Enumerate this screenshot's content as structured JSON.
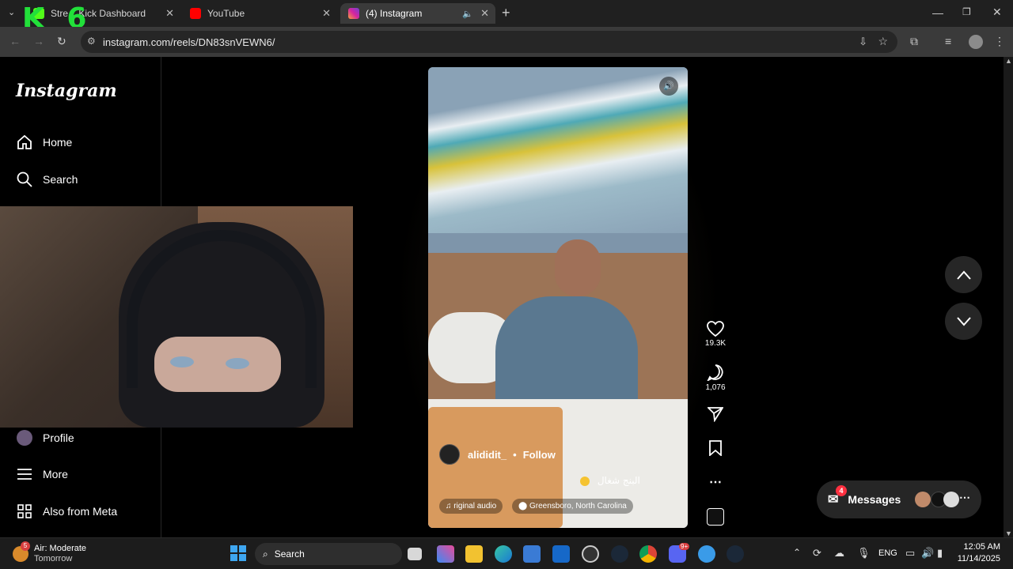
{
  "browser": {
    "tabs": [
      {
        "title": "Stre... Kick Dashboard",
        "color": "#53fc18"
      },
      {
        "title": "YouTube",
        "color": "#ff0000"
      },
      {
        "title": "(4) Instagram",
        "color": "#d6249f"
      }
    ],
    "url": "instagram.com/reels/DN83snVEWN6/"
  },
  "overlay_text": "K 6",
  "instagram": {
    "logo": "Instagram",
    "nav": {
      "home": "Home",
      "search": "Search",
      "profile": "Profile",
      "more": "More",
      "also_from_meta": "Also from Meta"
    },
    "reel": {
      "username": "alididit_",
      "follow": "Follow",
      "caption": "البنج شغال",
      "audio": "riginal audio",
      "location": "Greensboro, North Carolina",
      "likes": "19.3K",
      "comments": "1,076"
    },
    "messages": {
      "label": "Messages",
      "badge": "4"
    }
  },
  "taskbar": {
    "weather_badge": "5",
    "weather_title": "Air: Moderate",
    "weather_sub": "Tomorrow",
    "search": "Search",
    "lang": "ENG",
    "time": "12:05 AM",
    "date": "11/14/2025",
    "discord_badge": "9+"
  }
}
